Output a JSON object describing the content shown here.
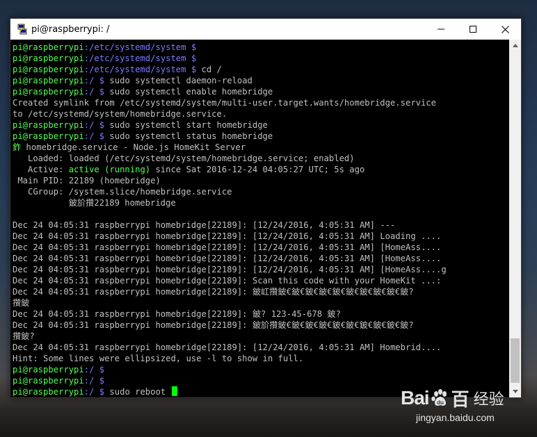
{
  "window": {
    "title": "pi@raspberrypi: /"
  },
  "colors": {
    "prompt_user": "#54ff54",
    "prompt_path": "#7a7aff",
    "output": "#c0c0c0",
    "cursor": "#00ff00",
    "active_status": "#54ff54"
  },
  "terminal": {
    "lines": [
      [
        {
          "t": "pi@raspberrypi",
          "c": "g"
        },
        {
          "t": ":/etc/systemd/system $",
          "c": "b"
        }
      ],
      [
        {
          "t": "pi@raspberrypi",
          "c": "g"
        },
        {
          "t": ":/etc/systemd/system $",
          "c": "b"
        }
      ],
      [
        {
          "t": "pi@raspberrypi",
          "c": "g"
        },
        {
          "t": ":/etc/systemd/system $",
          "c": "b"
        },
        {
          "t": " cd /",
          "c": ""
        }
      ],
      [
        {
          "t": "pi@raspberrypi",
          "c": "g"
        },
        {
          "t": ":/ $",
          "c": "b"
        },
        {
          "t": " sudo systemctl daemon-reload",
          "c": ""
        }
      ],
      [
        {
          "t": "pi@raspberrypi",
          "c": "g"
        },
        {
          "t": ":/ $",
          "c": "b"
        },
        {
          "t": " sudo systemctl enable homebridge",
          "c": ""
        }
      ],
      [
        {
          "t": "Created symlink from /etc/systemd/system/multi-user.target.wants/homebridge.service",
          "c": ""
        }
      ],
      [
        {
          "t": "to /etc/systemd/system/homebridge.service.",
          "c": ""
        }
      ],
      [
        {
          "t": "pi@raspberrypi",
          "c": "g"
        },
        {
          "t": ":/ $",
          "c": "b"
        },
        {
          "t": " sudo systemctl start homebridge",
          "c": ""
        }
      ],
      [
        {
          "t": "pi@raspberrypi",
          "c": "g"
        },
        {
          "t": ":/ $",
          "c": "b"
        },
        {
          "t": " sudo systemctl status homebridge",
          "c": ""
        }
      ],
      [
        {
          "t": "鈼",
          "c": "g"
        },
        {
          "t": " homebridge.service - Node.js HomeKit Server",
          "c": ""
        }
      ],
      [
        {
          "t": "   Loaded: loaded (/etc/systemd/system/homebridge.service; enabled)",
          "c": ""
        }
      ],
      [
        {
          "t": "   Active: ",
          "c": ""
        },
        {
          "t": "active (running)",
          "c": "g"
        },
        {
          "t": " since Sat 2016-12-24 04:05:27 UTC; 5s ago",
          "c": ""
        }
      ],
      [
        {
          "t": " Main PID: 22189 (homebridge)",
          "c": ""
        }
      ],
      [
        {
          "t": "   CGroup: /system.slice/homebridge.service",
          "c": ""
        }
      ],
      [
        {
          "t": "           鈹斺攢22189 homebridge",
          "c": ""
        }
      ],
      [
        {
          "t": "",
          "c": ""
        }
      ],
      [
        {
          "t": "Dec 24 04:05:31 raspberrypi homebridge[22189]: [12/24/2016, 4:05:31 AM] ---",
          "c": ""
        }
      ],
      [
        {
          "t": "Dec 24 04:05:31 raspberrypi homebridge[22189]: [12/24/2016, 4:05:31 AM] Loading ....",
          "c": ""
        }
      ],
      [
        {
          "t": "Dec 24 04:05:31 raspberrypi homebridge[22189]: [12/24/2016, 4:05:31 AM] [HomeAss....",
          "c": ""
        }
      ],
      [
        {
          "t": "Dec 24 04:05:31 raspberrypi homebridge[22189]: [12/24/2016, 4:05:31 AM] [HomeAss....",
          "c": ""
        }
      ],
      [
        {
          "t": "Dec 24 04:05:31 raspberrypi homebridge[22189]: [12/24/2016, 4:05:31 AM] [HomeAss....g",
          "c": ""
        }
      ],
      [
        {
          "t": "Dec 24 04:05:31 raspberrypi homebridge[22189]: Scan this code with your HomeKit ...:",
          "c": ""
        }
      ],
      [
        {
          "t": "Dec 24 04:05:31 raspberrypi homebridge[22189]: 鈹屸攢鈹€鈹€鈹€鈹€鈹€鈹€鈹€鈹€鈹€鈹?",
          "c": ""
        }
      ],
      [
        {
          "t": "攢鈹",
          "c": ""
        }
      ],
      [
        {
          "t": "Dec 24 04:05:31 raspberrypi homebridge[22189]: 鈹? 123-45-678 鈹?",
          "c": ""
        }
      ],
      [
        {
          "t": "Dec 24 04:05:31 raspberrypi homebridge[22189]: 鈹斺攢鈹€鈹€鈹€鈹€鈹€鈹€鈹€鈹€鈹€鈹?",
          "c": ""
        }
      ],
      [
        {
          "t": "攢鈹?",
          "c": ""
        }
      ],
      [
        {
          "t": "Dec 24 04:05:31 raspberrypi homebridge[22189]: [12/24/2016, 4:05:31 AM] Homebrid....",
          "c": ""
        }
      ],
      [
        {
          "t": "Hint: Some lines were ellipsized, use -l to show in full.",
          "c": ""
        }
      ],
      [
        {
          "t": "pi@raspberrypi",
          "c": "g"
        },
        {
          "t": ":/ $",
          "c": "b"
        }
      ],
      [
        {
          "t": "pi@raspberrypi",
          "c": "g"
        },
        {
          "t": ":/ $",
          "c": "b"
        }
      ],
      [
        {
          "t": "pi@raspberrypi",
          "c": "g"
        },
        {
          "t": ":/ $",
          "c": "b"
        },
        {
          "t": " sudo reboot ",
          "c": ""
        }
      ]
    ]
  },
  "watermark": {
    "logo_left": "Bai",
    "logo_right": "百",
    "brand_cn": "经验",
    "url": "jingyan.baidu.com"
  },
  "icons": {
    "app": "putty-icon",
    "minimize": "minimize-icon",
    "maximize": "maximize-icon",
    "close": "close-icon",
    "scroll_up": "scroll-up-arrow-icon",
    "scroll_down": "scroll-down-arrow-icon",
    "paw": "baidu-paw-logo-icon"
  }
}
